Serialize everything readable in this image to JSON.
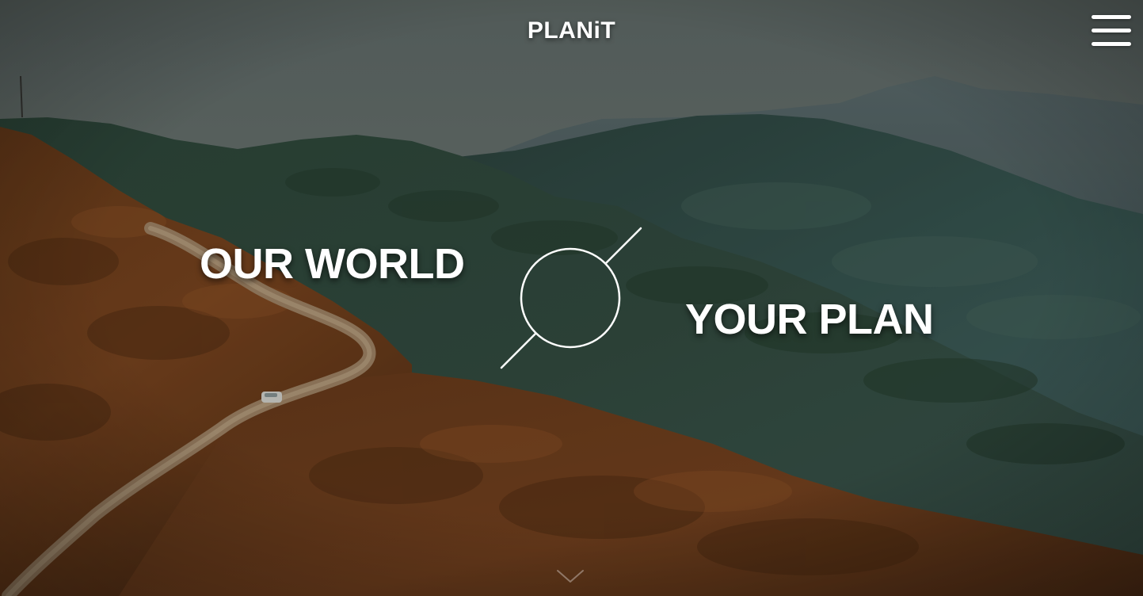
{
  "header": {
    "logo_text": "PLANiT",
    "menu_icon": "hamburger-menu-icon"
  },
  "hero": {
    "headline_left": "OUR WORLD",
    "headline_right": "YOUR PLAN",
    "emblem_icon": "circle-slash-emblem-icon",
    "scroll_icon": "chevron-down-icon"
  },
  "colors": {
    "text": "#ffffff",
    "sky": "#6f7b78",
    "forest": "#3d5a54",
    "hillside": "#8a4a1f",
    "road": "#b89a78"
  }
}
